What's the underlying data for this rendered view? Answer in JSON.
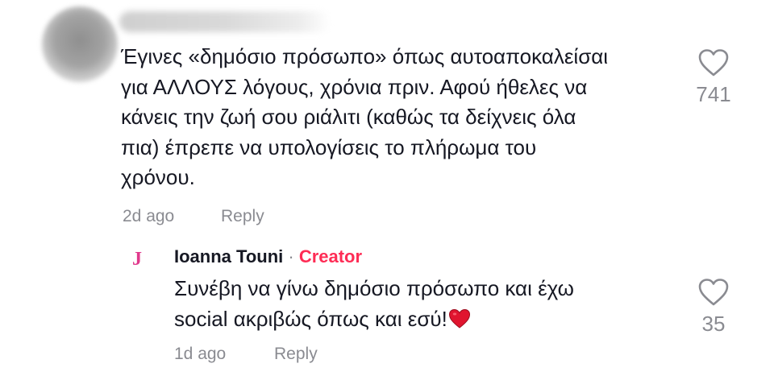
{
  "comment": {
    "text": "Έγινες «δημόσιο πρόσωπο» όπως αυτοαποκαλείσαι\nγια ΑΛΛΟΥΣ λόγους, χρόνια πριν. Αφού ήθελες να\nκάνεις την ζωή σου ριάλιτι (καθώς τα δείχνεις όλα\nπια) έπρεπε να υπολογίσεις το πλήρωμα του\nχρόνου.",
    "time": "2d ago",
    "reply_label": "Reply",
    "like_count": "741",
    "like_icon": "heart-outline-icon"
  },
  "reply": {
    "avatar_letter": "J",
    "author": "Ioanna Touni",
    "separator": " · ",
    "badge": "Creator",
    "text": "Συνέβη να γίνω δημόσιο πρόσωπο και έχω\nsocial ακριβώς όπως και εσύ!",
    "emoji": "red-heart-emoji",
    "time": "1d ago",
    "reply_label": "Reply",
    "like_count": "35",
    "like_icon": "heart-outline-icon"
  },
  "colors": {
    "text": "#161823",
    "muted": "#8a8b91",
    "creator": "#fe2c55",
    "avatar_letter": "#e0398c",
    "heart_emoji": "#e0152f"
  }
}
